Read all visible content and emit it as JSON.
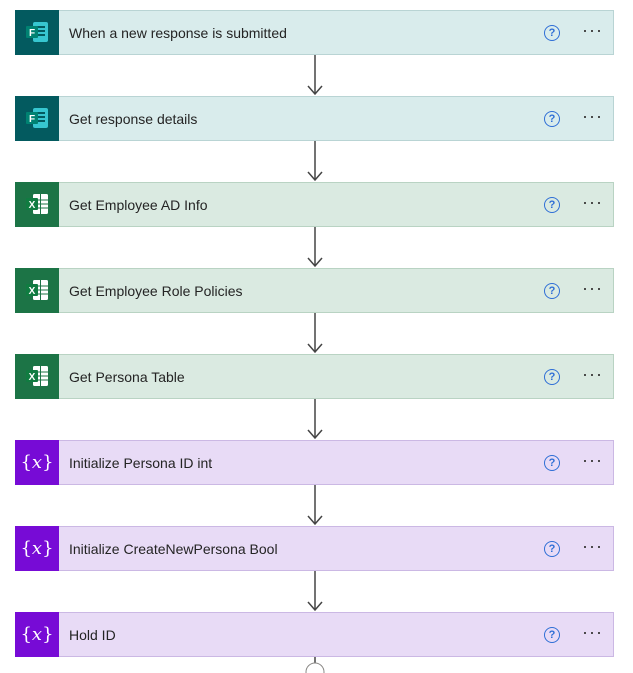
{
  "steps": [
    {
      "label": "When a new response is submitted",
      "kind": "forms",
      "icon": "microsoft-forms-icon"
    },
    {
      "label": "Get response details",
      "kind": "forms",
      "icon": "microsoft-forms-icon"
    },
    {
      "label": "Get Employee AD Info",
      "kind": "excel",
      "icon": "excel-icon"
    },
    {
      "label": "Get Employee Role Policies",
      "kind": "excel",
      "icon": "excel-icon"
    },
    {
      "label": "Get Persona Table",
      "kind": "excel",
      "icon": "excel-icon"
    },
    {
      "label": "Initialize Persona ID int",
      "kind": "var",
      "icon": "variable-icon"
    },
    {
      "label": "Initialize CreateNewPersona Bool",
      "kind": "var",
      "icon": "variable-icon"
    },
    {
      "label": "Hold ID",
      "kind": "var",
      "icon": "variable-icon"
    }
  ],
  "help_glyph": "?",
  "more_glyph": "···",
  "colors": {
    "forms_bg": "#d9ecec",
    "forms_icon": "#035a5f",
    "excel_bg": "#daeae1",
    "excel_icon": "#1c7446",
    "var_bg": "#e8dbf6",
    "var_icon": "#770bd6",
    "help": "#2f6fd6"
  }
}
